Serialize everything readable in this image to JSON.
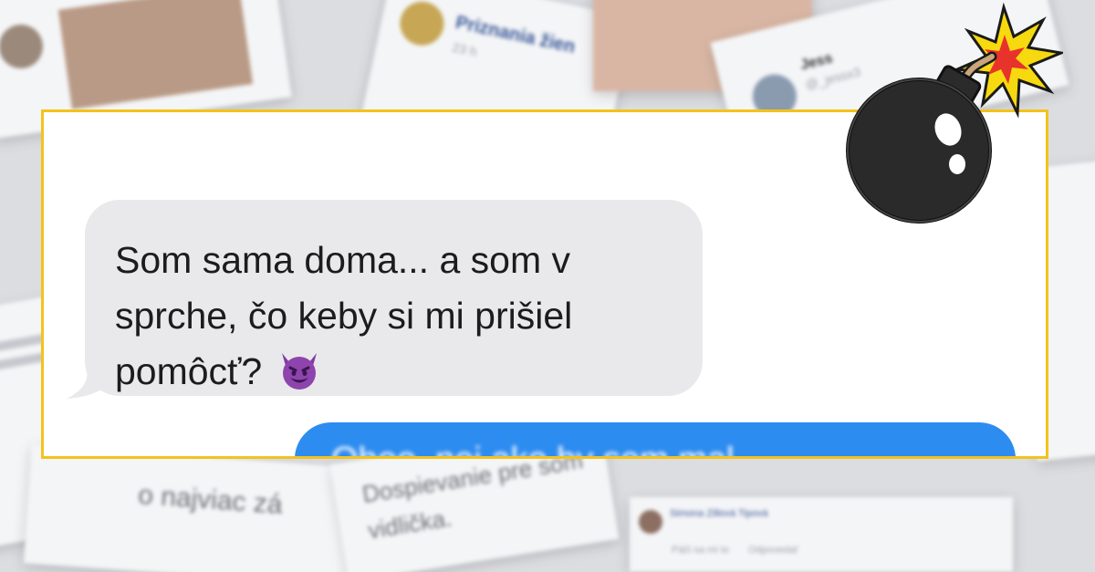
{
  "background": {
    "card_names": [
      "Priznania žien",
      "Jess",
      "@_jessx3"
    ],
    "card_timestamps": [
      "23 h"
    ],
    "card_snippets": [
      "Dospievanie pre som vidlička.",
      "o najviac zá"
    ],
    "comment": {
      "author": "Simona Zillová Tipová",
      "reply_actions": [
        "Páči sa mi to",
        "Odpovedať"
      ]
    }
  },
  "conversation": {
    "incoming_message": "Som sama doma... a som v sprche, čo keby si mi prišiel pomôcť?",
    "incoming_emoji": "smiling-face-with-horns",
    "outgoing_message_blurred": "Ohoo, nei ako by som mal..."
  },
  "colors": {
    "frame_border": "#f4c21b",
    "incoming_bubble": "#e9e9eb",
    "outgoing_bubble": "#2d8cf0",
    "emoji_purple": "#8e44ad"
  },
  "decoration": {
    "sticker": "bomb-icon"
  }
}
